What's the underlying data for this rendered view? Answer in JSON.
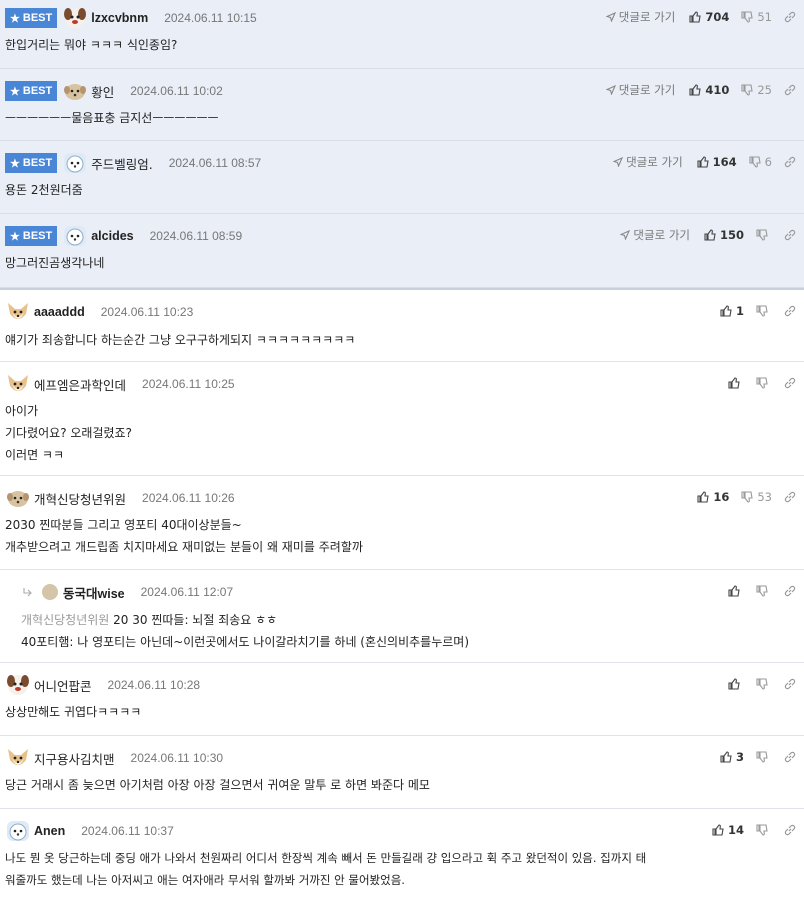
{
  "ui": {
    "goto_label": "댓글로 가기",
    "best_label": "BEST"
  },
  "comments": [
    {
      "best": true,
      "nick": "lzxcvbnm",
      "date": "2024.06.11 10:15",
      "up": "704",
      "down": "51",
      "lines": [
        "한입거리는 뭐야 ㅋㅋㅋ 식인종임?"
      ],
      "avatar": "dog-brown"
    },
    {
      "best": true,
      "nick": "황인",
      "date": "2024.06.11 10:02",
      "up": "410",
      "down": "25",
      "lines": [
        "ㅡㅡㅡㅡㅡㅡ물음표충 금지선ㅡㅡㅡㅡㅡㅡ"
      ],
      "avatar": "dog-small"
    },
    {
      "best": true,
      "nick": "주드벨링엄.",
      "date": "2024.06.11 08:57",
      "up": "164",
      "down": "6",
      "lines": [
        "용돈 2천원더줌"
      ],
      "avatar": "dog-white"
    },
    {
      "best": true,
      "nick": "alcides",
      "date": "2024.06.11 08:59",
      "up": "150",
      "down": "",
      "lines": [
        "망그러진곰생각나네"
      ],
      "avatar": "dog-white"
    },
    {
      "best": false,
      "nick": "aaaaddd",
      "date": "2024.06.11 10:23",
      "up": "1",
      "down": "",
      "lines": [
        "얘기가 죄송합니다 하는순간 그냥 오구구하게되지 ㅋㅋㅋㅋㅋㅋㅋㅋㅋ"
      ],
      "avatar": "dog-fox"
    },
    {
      "best": false,
      "nick": "에프엠은과학인데",
      "date": "2024.06.11 10:25",
      "up": "",
      "down": "",
      "lines": [
        "아이가",
        "기다렸어요? 오래걸렸죠?",
        "이러면 ㅋㅋ"
      ],
      "avatar": "dog-fox"
    },
    {
      "best": false,
      "nick": "개혁신당청년위원",
      "date": "2024.06.11 10:26",
      "up": "16",
      "down": "53",
      "lines": [
        "2030 찐따분들 그리고 영포티 40대이상분들~",
        "개추받으려고 개드립좀 치지마세요 재미없는 분들이 왜 재미를 주려할까"
      ],
      "avatar": "dog-small"
    },
    {
      "best": false,
      "reply": true,
      "nick": "동국대wise",
      "date": "2024.06.11 12:07",
      "up": "",
      "down": "",
      "quote": "개혁신당청년위원",
      "lines": [
        "20 30 찐따들: 뇌절 죄송요 ㅎㅎ",
        "40포티햄: 나 영포티는 아닌데~이런곳에서도 나이갈라치기를 하네 (혼신의비추를누르며)"
      ],
      "avatar": "circle"
    },
    {
      "best": false,
      "nick": "어니언팝콘",
      "date": "2024.06.11 10:28",
      "up": "",
      "down": "",
      "lines": [
        "상상만해도 귀엽다ㅋㅋㅋㅋ"
      ],
      "avatar": "dog-brown"
    },
    {
      "best": false,
      "nick": "지구용사김치맨",
      "date": "2024.06.11 10:30",
      "up": "3",
      "down": "",
      "lines": [
        "당근 거래시 좀 늦으면 아기처럼 아장 아장 걸으면서 귀여운 말투 로 하면 봐준다 메모"
      ],
      "avatar": "dog-fox"
    },
    {
      "best": false,
      "nick": "Anen",
      "date": "2024.06.11 10:37",
      "up": "14",
      "down": "",
      "lines": [
        "나도 뭔 옷 당근하는데 중딩 애가 나와서 천원짜리 어디서 한장씩 계속 빼서 돈 만들길래 걍 입으라고 휙 주고 왔던적이 있음. 집까지 태",
        "워줄까도 했는데 나는 아저씨고 애는 여자애라 무서워 할까봐 거까진 안 물어봤었음."
      ],
      "avatar": "dog-white"
    }
  ]
}
